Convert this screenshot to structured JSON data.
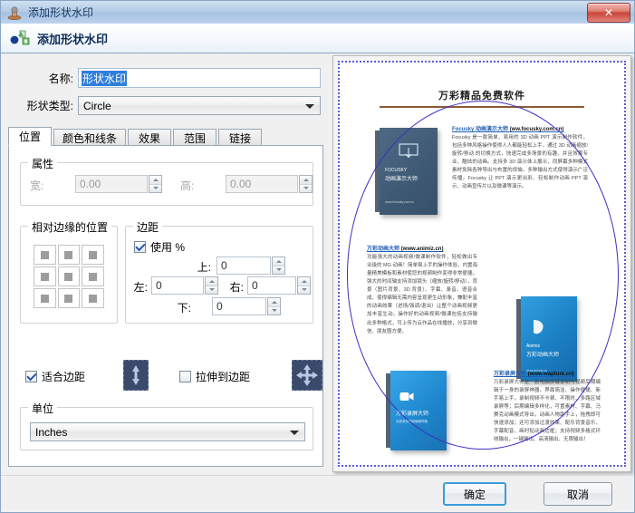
{
  "window": {
    "title": "添加形状水印",
    "icon": "stamp-icon",
    "close_label": "✕"
  },
  "header": {
    "title": "添加形状水印",
    "icon": "shape-watermark-icon"
  },
  "form": {
    "name_label": "名称:",
    "name_value": "形状水印",
    "shape_type_label": "形状类型:",
    "shape_type_value": "Circle"
  },
  "tabs": [
    {
      "label": "位置",
      "active": true
    },
    {
      "label": "颜色和线条",
      "active": false
    },
    {
      "label": "效果",
      "active": false
    },
    {
      "label": "范围",
      "active": false
    },
    {
      "label": "链接",
      "active": false
    }
  ],
  "properties": {
    "group_title": "属性",
    "width_label": "宽:",
    "width_value": "0.00",
    "height_label": "高:",
    "height_value": "0.00"
  },
  "position_relative": {
    "group_title": "相对边缘的位置",
    "cells": [
      "anchor-top-left",
      "anchor-top-center",
      "anchor-top-right",
      "anchor-middle-left",
      "anchor-middle-center",
      "anchor-middle-right",
      "anchor-bottom-left",
      "anchor-bottom-center",
      "anchor-bottom-right"
    ]
  },
  "margins": {
    "group_title": "边距",
    "use_percent_label": "使用 %",
    "use_percent_checked": true,
    "top_label": "上:",
    "top_value": "0",
    "left_label": "左:",
    "left_value": "0",
    "right_label": "右:",
    "right_value": "0",
    "bottom_label": "下:",
    "bottom_value": "0"
  },
  "options": {
    "fit_label": "适合边距",
    "fit_checked": true,
    "fit_icon": "arrows-vertical-icon",
    "stretch_label": "拉伸到边距",
    "stretch_checked": false,
    "stretch_icon": "arrows-four-way-icon"
  },
  "units": {
    "group_title": "单位",
    "value": "Inches"
  },
  "preview": {
    "doc_title": "万彩精品免费软件",
    "watermark_shape": "circle",
    "watermark_color": "#3b2fbf",
    "sections": [
      {
        "heading": "Focusky 动画演示大师",
        "site": "(ww.focusky.com.cn)",
        "body": "Focusky 是一款简单、易用的 3D 动画 PPT 演示制作软件，包括多种风格操作使得人人都能轻松上手，通过 3D 动画缩放/旋转/移动 的切换方式，快速完成多场景的有趣、并且效果专业、酷炫的动画。支持多 3D 演示体上展示，同屏幕多种模式素材免除各种导出与布置的烦恼，多种输出方式使得演示广泛传播。Focusky 让 PPT 演示更出彩、轻松制作动画 PPT 演示、动画宣传片以及微课等演示。"
      },
      {
        "heading": "万彩动画大师",
        "site": "(www.animiz.cn)",
        "body": "功能强大的动画视频/微课制作软件，轻松做出专业级的 MG 动画！简单易上手的操作体验，内置海量精美模板和素材使您的视频制作变得非常便捷。强大的时间轴支持添加镜头（缩放/旋转/移动），背景（图片背景、3D 背景）、字幕、录音、语音合成、使得编辑无需内容呈现更生动形象，兼配丰富的动画效果（进场/强调/退出）让整个动画视频更加丰富生动。操作好的动画视频/微课包括支持输出多种格式，可上传为云作品在线播放，分享到微信、朋友圈方便。"
      },
      {
        "heading": "万彩录屏大师",
        "site": "(www.wapture.cn)",
        "body": "万彩录屏大师是一款电脑屏幕录制与视频后期编辑于一身的录屏神器。界面简洁、操作便捷、新手易上手，录制视频不卡顿、不限时、多路区域录屏等；后期编辑多样化，可置素材、字幕、马赛克动画模式导出，动画人物助手上，拖拽即可快速添加；还可添加过渡效果、配乐背景音乐、字幕配音、画时贴动画边框；支持视频多格式环绕输出，一键输出、高清输出、无限输出！"
      }
    ]
  },
  "footer": {
    "ok_label": "确定",
    "cancel_label": "取消"
  }
}
